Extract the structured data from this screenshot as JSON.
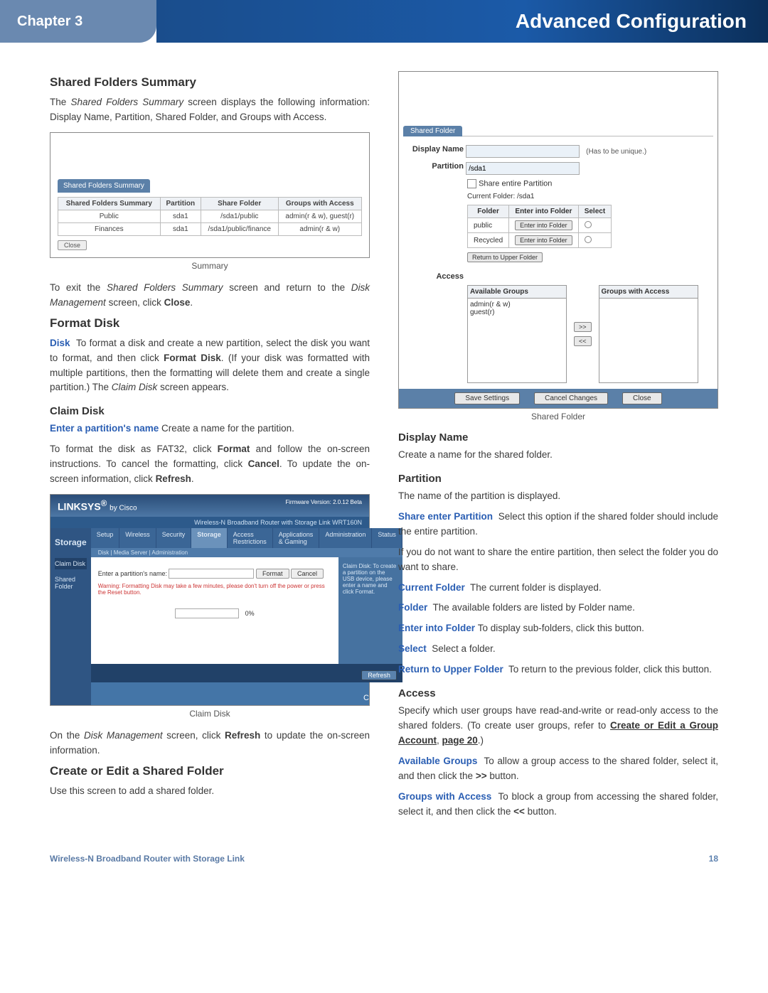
{
  "header": {
    "chapter": "Chapter 3",
    "title": "Advanced Configuration"
  },
  "left": {
    "h_sfs": "Shared Folders Summary",
    "p_sfs": "The <em>Shared Folders Summary</em> screen displays the following information: Display Name, Partition, Shared Folder, and Groups with Access.",
    "summary_tab": "Shared Folders Summary",
    "summary_cols": [
      "Shared Folders Summary",
      "Partition",
      "Share Folder",
      "Groups with Access"
    ],
    "summary_rows": [
      [
        "Public",
        "sda1",
        "/sda1/public",
        "admin(r & w), guest(r)"
      ],
      [
        "Finances",
        "sda1",
        "/sda1/public/finance",
        "admin(r & w)"
      ]
    ],
    "close_btn": "Close",
    "cap_summary": "Summary",
    "p_exit": "To exit the <em>Shared Folders Summary</em> screen and return to the <em>Disk Management</em> screen, click <strong>Close</strong>.",
    "h_format": "Format Disk",
    "p_format": "<span class=\"term\">Disk</span>&nbsp; To format a disk and create a new partition, select the disk you want to format, and then click <strong>Format Disk</strong>. (If your disk was formatted with multiple partitions, then the formatting will delete them and create a single partition.) The <em>Claim Disk</em> screen appears.",
    "h_claim": "Claim Disk",
    "p_claim1": "<span class=\"term\">Enter a partition's name</span> Create a name for the partition.",
    "p_claim2": "To format the disk as FAT32, click <strong>Format</strong> and follow the on-screen instructions. To cancel the formatting, click <strong>Cancel</strong>. To update the on-screen information, click <strong>Refresh</strong>.",
    "claim": {
      "brand": "LINKSYS",
      "by": "by Cisco",
      "bar_text": "Wireless-N Broadband Router with Storage Link    WRT160N",
      "tabs": [
        "Setup",
        "Wireless",
        "Security",
        "Storage",
        "Access Restrictions",
        "Applications & Gaming",
        "Administration",
        "Status"
      ],
      "subtabs": "Disk   |   Media Server   |   Administration",
      "nav_storage": "Storage",
      "nav_items": [
        "Claim Disk",
        "",
        "Shared Folder"
      ],
      "enter_label": "Enter a partition's name:",
      "format": "Format",
      "cancel": "Cancel",
      "warn": "Warning: Formatting Disk may take a few minutes, please don't turn off the power or press the Reset button.",
      "pct": "0%",
      "refresh": "Refresh",
      "right_text": "Claim Disk: To create a partition on the USB device, please enter a name and click Format.",
      "cisco1": "ılıılı",
      "cisco2": "CISCO"
    },
    "cap_claim": "Claim Disk",
    "p_after_claim": "On the <em>Disk Management</em> screen, click <strong>Refresh</strong> to update the on-screen information.",
    "h_create": "Create or Edit a Shared Folder",
    "p_create": "Use this screen to add a shared folder."
  },
  "right": {
    "sf": {
      "tab": "Shared Folder",
      "display_label": "Display Name",
      "display_note": "(Has to be unique.)",
      "partition_label": "Partition",
      "partition_value": "/sda1",
      "share_entire": "Share entire Partition",
      "cur_folder": "Current Folder: /sda1",
      "th_folder": "Folder",
      "th_enter": "Enter into Folder",
      "th_select": "Select",
      "rows": [
        {
          "name": "public",
          "btn": "Enter into Folder"
        },
        {
          "name": "Recycled",
          "btn": "Enter into Folder"
        }
      ],
      "return_btn": "Return to Upper Folder",
      "access_label": "Access",
      "avail_hdr": "Available Groups",
      "with_hdr": "Groups with Access",
      "avail_items": [
        "admin(r & w)",
        "guest(r)"
      ],
      "btn_r": ">>",
      "btn_l": "<<",
      "save": "Save Settings",
      "cancel": "Cancel Changes",
      "close": "Close"
    },
    "cap_sf": "Shared Folder",
    "h_dn": "Display Name",
    "p_dn": "Create a name for the shared folder.",
    "h_part": "Partition",
    "p_part": "The name of the partition is displayed.",
    "p_share": "<span class=\"term\">Share enter Partition</span>&nbsp; Select this option if the shared folder should include the entire partition.",
    "p_share2": "If you do not want to share the entire partition, then select the folder you do want to share.",
    "p_cur": "<span class=\"term\">Current Folder</span>&nbsp; The current folder is displayed.",
    "p_fold": "<span class=\"term\">Folder</span>&nbsp; The available folders are listed by Folder name.",
    "p_enter": "<span class=\"term\">Enter into Folder</span>&nbsp;To display sub-folders, click this button.",
    "p_sel": "<span class=\"term\">Select</span>&nbsp; Select a folder.",
    "p_ret": "<span class=\"term\">Return to Upper Folder</span>&nbsp; To return to the previous folder, click this button.",
    "h_acc": "Access",
    "p_acc": "Specify which user groups have read-and-write or read-only access to the shared folders. (To create user groups, refer to <a class=\"ref\">Create or Edit a Group Account</a>, <a class=\"ref\">page 20</a>.)",
    "p_ag": "<span class=\"term\">Available Groups</span>&nbsp; To allow a group access to the shared folder, select it, and then click the <strong>&gt;&gt;</strong> button.",
    "p_gw": "<span class=\"term\">Groups with Access</span>&nbsp; To block a group from accessing the shared folder, select it, and then click the <strong>&lt;&lt;</strong> button."
  },
  "footer": {
    "product": "Wireless-N Broadband Router with Storage Link",
    "page": "18"
  }
}
